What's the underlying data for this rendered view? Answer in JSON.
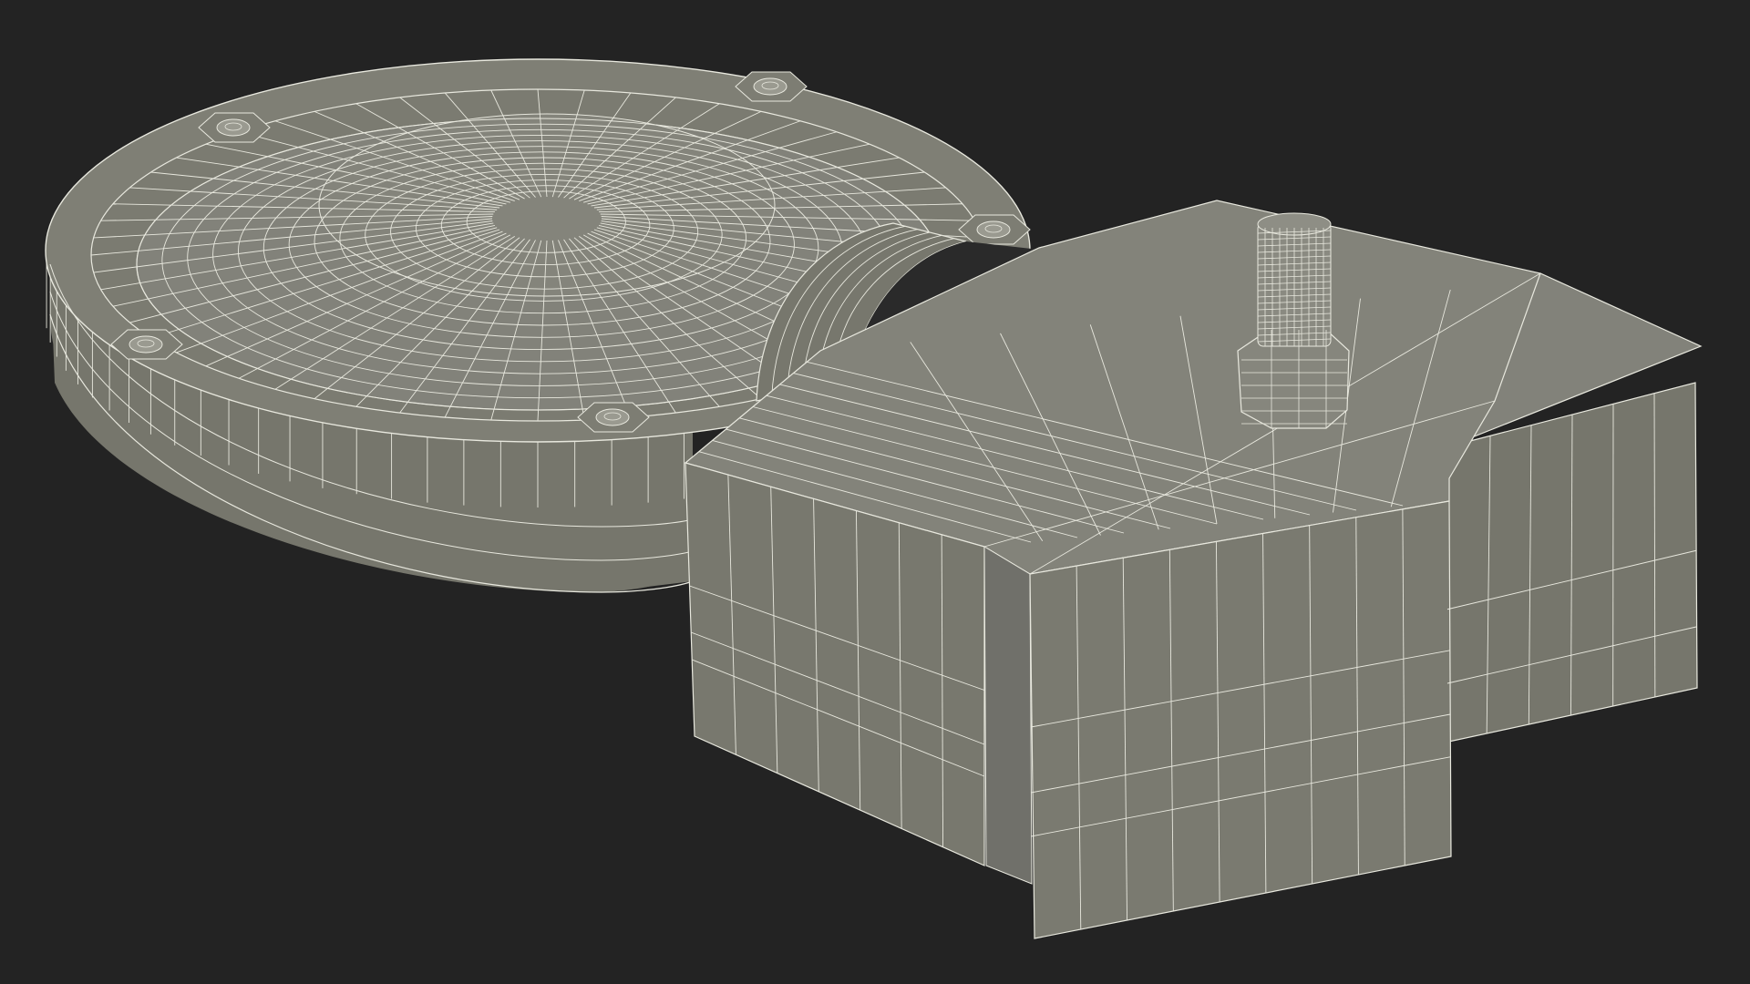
{
  "scene": {
    "subject": "wireframe-render",
    "colors": {
      "background": "#232323",
      "surface": "#7a7a70",
      "surface_top": "#85857b",
      "surface_light": "#8e8e84",
      "surface_shadow": "#5f5f57",
      "wire": "#e8e8de"
    },
    "icons": [
      "bolt-icon",
      "threaded-stud-icon"
    ]
  }
}
